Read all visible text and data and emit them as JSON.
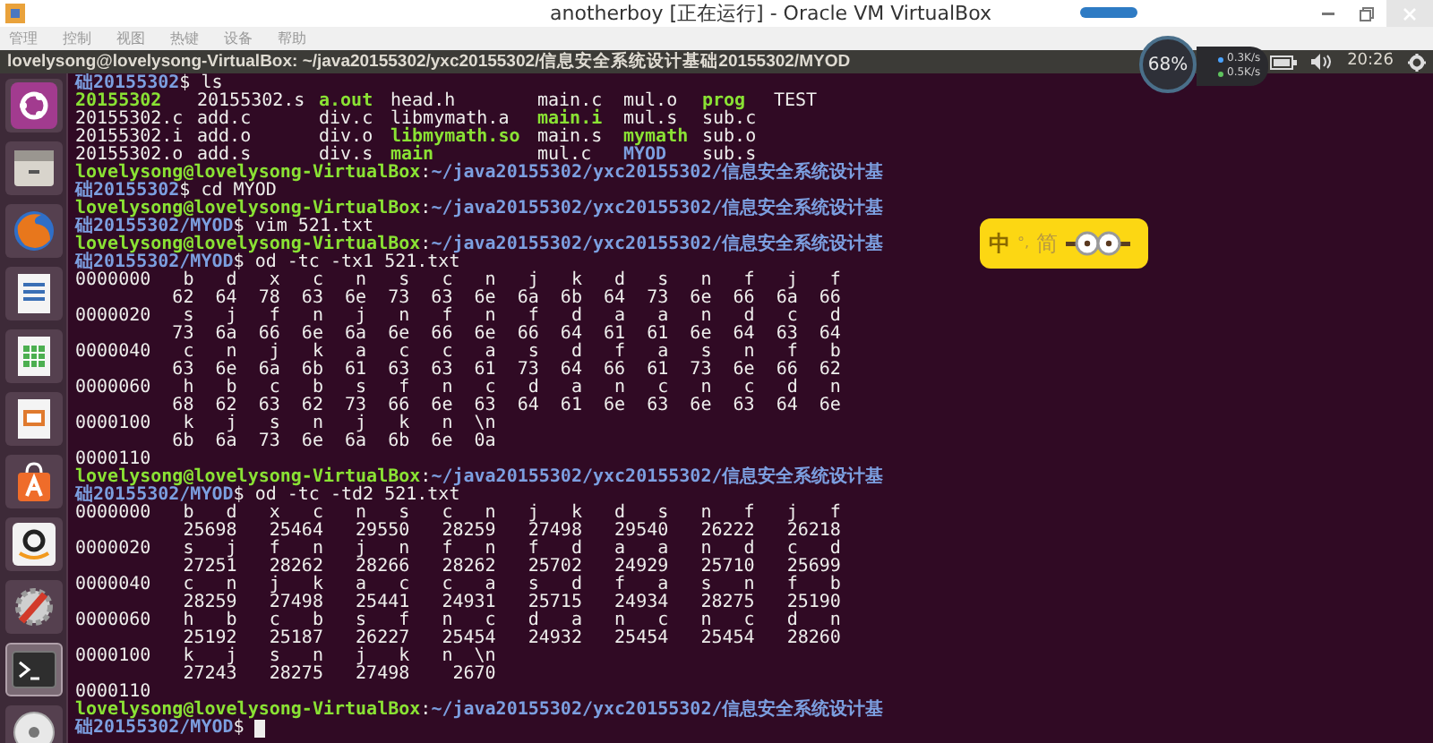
{
  "window": {
    "title": "anotherboy [正在运行] - Oracle VM VirtualBox"
  },
  "menu": [
    "管理",
    "控制",
    "视图",
    "热键",
    "设备",
    "帮助"
  ],
  "top_panel": {
    "title": "lovelysong@lovelysong-VirtualBox: ~/java20155302/yxc20155302/信息安全系统设计基础20155302/MYOD",
    "clock": "20:26"
  },
  "net_widget": {
    "percent": "68%",
    "up": "0.3K/s",
    "down": "0.5K/s"
  },
  "launcher": [
    {
      "kind": "ubuntu",
      "selected": false
    },
    {
      "kind": "files",
      "selected": false
    },
    {
      "kind": "browser",
      "selected": false
    },
    {
      "kind": "writer",
      "selected": false
    },
    {
      "kind": "calc",
      "selected": false
    },
    {
      "kind": "impress",
      "selected": false
    },
    {
      "kind": "store",
      "selected": false
    },
    {
      "kind": "shop",
      "selected": false
    },
    {
      "kind": "settings",
      "selected": false
    },
    {
      "kind": "terminal",
      "selected": true
    },
    {
      "kind": "disc",
      "selected": false
    }
  ],
  "ime": {
    "mode": "中",
    "punct": "°,",
    "script": "简"
  },
  "terminal": [
    {
      "kind": "text",
      "segments": [
        {
          "text": "础20155302",
          "kind": "path"
        },
        {
          "text": "$ ls",
          "kind": "plain"
        }
      ]
    },
    {
      "kind": "ls",
      "cells": [
        {
          "name": "20155302",
          "kind": "exec"
        },
        {
          "name": "20155302.s",
          "kind": "file"
        },
        {
          "name": "a.out",
          "kind": "exec"
        },
        {
          "name": "head.h",
          "kind": "file"
        },
        {
          "name": "main.c",
          "kind": "file"
        },
        {
          "name": "mul.o",
          "kind": "file"
        },
        {
          "name": "prog",
          "kind": "exec"
        },
        {
          "name": "TEST",
          "kind": "file"
        }
      ]
    },
    {
      "kind": "ls",
      "cells": [
        {
          "name": "20155302.c",
          "kind": "file"
        },
        {
          "name": "add.c",
          "kind": "file"
        },
        {
          "name": "div.c",
          "kind": "file"
        },
        {
          "name": "libmymath.a",
          "kind": "file"
        },
        {
          "name": "main.i",
          "kind": "exec"
        },
        {
          "name": "mul.s",
          "kind": "file"
        },
        {
          "name": "sub.c",
          "kind": "file"
        }
      ]
    },
    {
      "kind": "ls",
      "cells": [
        {
          "name": "20155302.i",
          "kind": "file"
        },
        {
          "name": "add.o",
          "kind": "file"
        },
        {
          "name": "div.o",
          "kind": "file"
        },
        {
          "name": "libmymath.so",
          "kind": "exec"
        },
        {
          "name": "main.s",
          "kind": "file"
        },
        {
          "name": "mymath",
          "kind": "exec"
        },
        {
          "name": "sub.o",
          "kind": "file"
        }
      ]
    },
    {
      "kind": "ls",
      "cells": [
        {
          "name": "20155302.o",
          "kind": "file"
        },
        {
          "name": "add.s",
          "kind": "file"
        },
        {
          "name": "div.s",
          "kind": "file"
        },
        {
          "name": "main",
          "kind": "exec"
        },
        {
          "name": "mul.c",
          "kind": "file"
        },
        {
          "name": "MYOD",
          "kind": "dir"
        },
        {
          "name": "sub.s",
          "kind": "file"
        }
      ]
    },
    {
      "kind": "text",
      "segments": [
        {
          "text": "lovelysong@lovelysong-VirtualBox",
          "kind": "user"
        },
        {
          "text": ":",
          "kind": "plain"
        },
        {
          "text": "~/java20155302/yxc20155302/信息安全系统设计基",
          "kind": "path"
        }
      ]
    },
    {
      "kind": "text",
      "segments": [
        {
          "text": "础20155302",
          "kind": "path"
        },
        {
          "text": "$ cd MYOD",
          "kind": "plain"
        }
      ]
    },
    {
      "kind": "text",
      "segments": [
        {
          "text": "lovelysong@lovelysong-VirtualBox",
          "kind": "user"
        },
        {
          "text": ":",
          "kind": "plain"
        },
        {
          "text": "~/java20155302/yxc20155302/信息安全系统设计基",
          "kind": "path"
        }
      ]
    },
    {
      "kind": "text",
      "segments": [
        {
          "text": "础20155302/MYOD",
          "kind": "path"
        },
        {
          "text": "$ vim 521.txt",
          "kind": "plain"
        }
      ]
    },
    {
      "kind": "text",
      "segments": [
        {
          "text": "lovelysong@lovelysong-VirtualBox",
          "kind": "user"
        },
        {
          "text": ":",
          "kind": "plain"
        },
        {
          "text": "~/java20155302/yxc20155302/信息安全系统设计基",
          "kind": "path"
        }
      ]
    },
    {
      "kind": "text",
      "segments": [
        {
          "text": "础20155302/MYOD",
          "kind": "path"
        },
        {
          "text": "$ od -tc -tx1 521.txt",
          "kind": "plain"
        }
      ]
    },
    {
      "kind": "text",
      "segments": [
        {
          "text": "0000000   b   d   x   c   n   s   c   n   j   k   d   s   n   f   j   f",
          "kind": "plain"
        }
      ]
    },
    {
      "kind": "text",
      "segments": [
        {
          "text": "         62  64  78  63  6e  73  63  6e  6a  6b  64  73  6e  66  6a  66",
          "kind": "plain"
        }
      ]
    },
    {
      "kind": "text",
      "segments": [
        {
          "text": "0000020   s   j   f   n   j   n   f   n   f   d   a   a   n   d   c   d",
          "kind": "plain"
        }
      ]
    },
    {
      "kind": "text",
      "segments": [
        {
          "text": "         73  6a  66  6e  6a  6e  66  6e  66  64  61  61  6e  64  63  64",
          "kind": "plain"
        }
      ]
    },
    {
      "kind": "text",
      "segments": [
        {
          "text": "0000040   c   n   j   k   a   c   c   a   s   d   f   a   s   n   f   b",
          "kind": "plain"
        }
      ]
    },
    {
      "kind": "text",
      "segments": [
        {
          "text": "         63  6e  6a  6b  61  63  63  61  73  64  66  61  73  6e  66  62",
          "kind": "plain"
        }
      ]
    },
    {
      "kind": "text",
      "segments": [
        {
          "text": "0000060   h   b   c   b   s   f   n   c   d   a   n   c   n   c   d   n",
          "kind": "plain"
        }
      ]
    },
    {
      "kind": "text",
      "segments": [
        {
          "text": "         68  62  63  62  73  66  6e  63  64  61  6e  63  6e  63  64  6e",
          "kind": "plain"
        }
      ]
    },
    {
      "kind": "text",
      "segments": [
        {
          "text": "0000100   k   j   s   n   j   k   n  \\n",
          "kind": "plain"
        }
      ]
    },
    {
      "kind": "text",
      "segments": [
        {
          "text": "         6b  6a  73  6e  6a  6b  6e  0a",
          "kind": "plain"
        }
      ]
    },
    {
      "kind": "text",
      "segments": [
        {
          "text": "0000110",
          "kind": "plain"
        }
      ]
    },
    {
      "kind": "text",
      "segments": [
        {
          "text": "lovelysong@lovelysong-VirtualBox",
          "kind": "user"
        },
        {
          "text": ":",
          "kind": "plain"
        },
        {
          "text": "~/java20155302/yxc20155302/信息安全系统设计基",
          "kind": "path"
        }
      ]
    },
    {
      "kind": "text",
      "segments": [
        {
          "text": "础20155302/MYOD",
          "kind": "path"
        },
        {
          "text": "$ od -tc -td2 521.txt",
          "kind": "plain"
        }
      ]
    },
    {
      "kind": "text",
      "segments": [
        {
          "text": "0000000   b   d   x   c   n   s   c   n   j   k   d   s   n   f   j   f",
          "kind": "plain"
        }
      ]
    },
    {
      "kind": "text",
      "segments": [
        {
          "text": "          25698   25464   29550   28259   27498   29540   26222   26218",
          "kind": "plain"
        }
      ]
    },
    {
      "kind": "text",
      "segments": [
        {
          "text": "0000020   s   j   f   n   j   n   f   n   f   d   a   a   n   d   c   d",
          "kind": "plain"
        }
      ]
    },
    {
      "kind": "text",
      "segments": [
        {
          "text": "          27251   28262   28266   28262   25702   24929   25710   25699",
          "kind": "plain"
        }
      ]
    },
    {
      "kind": "text",
      "segments": [
        {
          "text": "0000040   c   n   j   k   a   c   c   a   s   d   f   a   s   n   f   b",
          "kind": "plain"
        }
      ]
    },
    {
      "kind": "text",
      "segments": [
        {
          "text": "          28259   27498   25441   24931   25715   24934   28275   25190",
          "kind": "plain"
        }
      ]
    },
    {
      "kind": "text",
      "segments": [
        {
          "text": "0000060   h   b   c   b   s   f   n   c   d   a   n   c   n   c   d   n",
          "kind": "plain"
        }
      ]
    },
    {
      "kind": "text",
      "segments": [
        {
          "text": "          25192   25187   26227   25454   24932   25454   25454   28260",
          "kind": "plain"
        }
      ]
    },
    {
      "kind": "text",
      "segments": [
        {
          "text": "0000100   k   j   s   n   j   k   n  \\n",
          "kind": "plain"
        }
      ]
    },
    {
      "kind": "text",
      "segments": [
        {
          "text": "          27243   28275   27498    2670",
          "kind": "plain"
        }
      ]
    },
    {
      "kind": "text",
      "segments": [
        {
          "text": "0000110",
          "kind": "plain"
        }
      ]
    },
    {
      "kind": "text",
      "segments": [
        {
          "text": "lovelysong@lovelysong-VirtualBox",
          "kind": "user"
        },
        {
          "text": ":",
          "kind": "plain"
        },
        {
          "text": "~/java20155302/yxc20155302/信息安全系统设计基",
          "kind": "path"
        }
      ]
    },
    {
      "kind": "text",
      "cursor": true,
      "segments": [
        {
          "text": "础20155302/MYOD",
          "kind": "path"
        },
        {
          "text": "$ ",
          "kind": "plain"
        }
      ]
    }
  ]
}
